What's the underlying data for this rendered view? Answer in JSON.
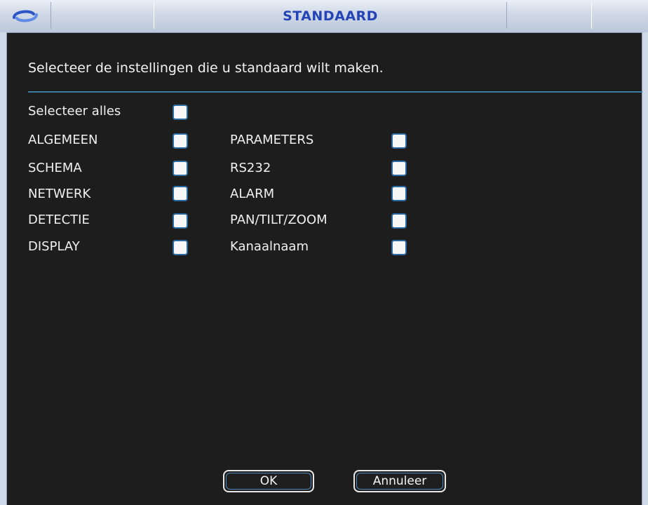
{
  "window": {
    "title": "STANDAARD",
    "logo_icon": "dahua-logo-icon"
  },
  "intro_text": "Selecteer de instellingen die u standaard wilt maken.",
  "select_all": {
    "label": "Selecteer alles",
    "checked": false
  },
  "left_items": [
    {
      "label": "ALGEMEEN",
      "checked": false
    },
    {
      "label": "SCHEMA",
      "checked": false
    },
    {
      "label": "NETWERK",
      "checked": false
    },
    {
      "label": "DETECTIE",
      "checked": false
    },
    {
      "label": "DISPLAY",
      "checked": false
    }
  ],
  "right_items": [
    {
      "label": "PARAMETERS",
      "checked": false
    },
    {
      "label": "RS232",
      "checked": false
    },
    {
      "label": "ALARM",
      "checked": false
    },
    {
      "label": "PAN/TILT/ZOOM",
      "checked": false
    },
    {
      "label": "Kanaalnaam",
      "checked": false
    }
  ],
  "buttons": {
    "ok": "OK",
    "cancel": "Annuleer"
  },
  "colors": {
    "title": "#2443b6",
    "divider": "#3c7aa3",
    "checkbox_border": "#2a6aa3",
    "background": "#1d1d1d"
  }
}
